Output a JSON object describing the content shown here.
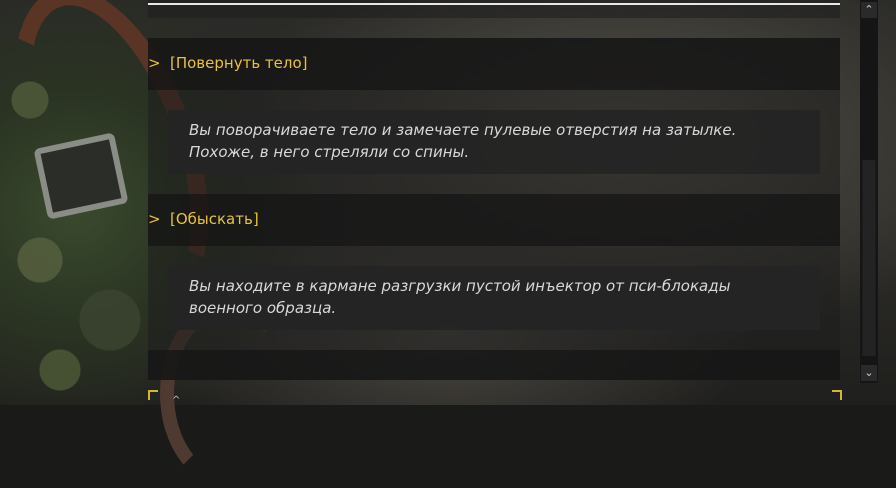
{
  "dialogue": {
    "options": [
      {
        "chevron": ">",
        "label": "[Повернуть тело]"
      },
      {
        "chevron": ">",
        "label": "[Обыскать]"
      }
    ],
    "responses": [
      {
        "text": "Вы поворачиваете тело и замечаете пулевые отверстия на затылке. Похоже, в него стреляли со спины."
      },
      {
        "text": "Вы находите в кармане разгрузки пустой инъектор от пси-блокады военного образца."
      }
    ]
  },
  "scroll": {
    "up_glyph": "⌃",
    "down_glyph": "⌄"
  },
  "colors": {
    "option_text": "#e8c23a",
    "response_text": "#d8d8d8",
    "corner_accent": "#d9b23a"
  },
  "icons": [
    "chevron-right-icon",
    "scroll-up-icon",
    "scroll-down-icon",
    "corner-bracket-icon"
  ]
}
